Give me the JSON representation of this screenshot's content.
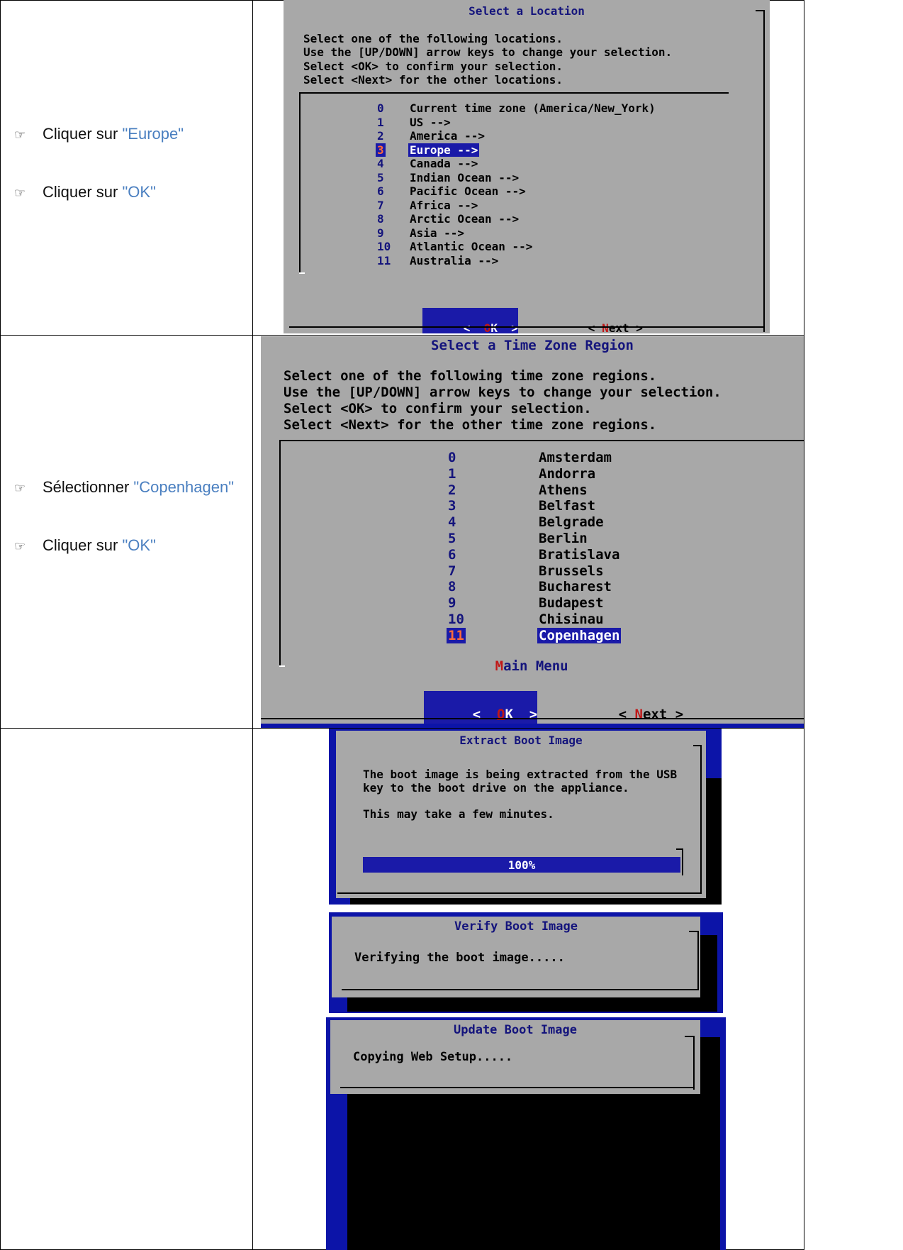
{
  "rows": [
    {
      "steps": [
        {
          "icon": "pointing-hand-icon",
          "prefix": "Cliquer sur ",
          "target": "\"Europe\""
        },
        {
          "icon": "pointing-hand-icon",
          "prefix": "Cliquer sur ",
          "target": "\"OK\""
        }
      ],
      "dialog": {
        "title": "Select a Location",
        "instructions": [
          "Select one of the following locations.",
          "Use the [UP/DOWN] arrow keys to change your selection.",
          "Select <OK> to confirm your selection.",
          "Select <Next> for the other locations."
        ],
        "items": [
          {
            "num": "0",
            "label": "Current time zone (America/New_York)"
          },
          {
            "num": "1",
            "label": "US -->"
          },
          {
            "num": "2",
            "label": "America -->"
          },
          {
            "num": "3",
            "label": "Europe -->"
          },
          {
            "num": "4",
            "label": "Canada -->"
          },
          {
            "num": "5",
            "label": "Indian Ocean -->"
          },
          {
            "num": "6",
            "label": "Pacific Ocean -->"
          },
          {
            "num": "7",
            "label": "Africa -->"
          },
          {
            "num": "8",
            "label": "Arctic Ocean -->"
          },
          {
            "num": "9",
            "label": "Asia -->"
          },
          {
            "num": "10",
            "label": "Atlantic Ocean -->"
          },
          {
            "num": "11",
            "label": "Australia -->"
          }
        ],
        "selected_index": 3,
        "ok_button": {
          "left": "<",
          "hot": "O",
          "rest": "K",
          "right": ">"
        },
        "next_button": {
          "left": "< ",
          "hot": "N",
          "rest": "ext",
          "right": " >"
        }
      }
    },
    {
      "steps": [
        {
          "icon": "pointing-hand-icon",
          "prefix": "Sélectionner ",
          "target": "\"Copenhagen\""
        },
        {
          "icon": "pointing-hand-icon",
          "prefix": "Cliquer sur ",
          "target": "\"OK\""
        }
      ],
      "dialog": {
        "title": "Select a Time Zone Region",
        "instructions": [
          "Select one of the following time zone regions.",
          "Use the [UP/DOWN] arrow keys to change your selection.",
          "Select <OK> to confirm your selection.",
          "Select <Next> for the other time zone regions."
        ],
        "items": [
          {
            "num": "0",
            "label": "Amsterdam"
          },
          {
            "num": "1",
            "label": "Andorra"
          },
          {
            "num": "2",
            "label": "Athens"
          },
          {
            "num": "3",
            "label": "Belfast"
          },
          {
            "num": "4",
            "label": "Belgrade"
          },
          {
            "num": "5",
            "label": "Berlin"
          },
          {
            "num": "6",
            "label": "Bratislava"
          },
          {
            "num": "7",
            "label": "Brussels"
          },
          {
            "num": "8",
            "label": "Bucharest"
          },
          {
            "num": "9",
            "label": "Budapest"
          },
          {
            "num": "10",
            "label": "Chisinau"
          },
          {
            "num": "11",
            "label": "Copenhagen"
          }
        ],
        "selected_index": 11,
        "main_menu": {
          "hot": "M",
          "rest": "ain Menu"
        },
        "ok_button": {
          "left": "<",
          "hot": "O",
          "rest": "K",
          "right": ">"
        },
        "next_button": {
          "left": "< ",
          "hot": "N",
          "rest": "ext",
          "right": " >"
        }
      }
    },
    {
      "dialogs": {
        "extract": {
          "title": "Extract Boot Image",
          "lines": [
            "The boot image is being extracted from the USB",
            "key to the boot drive on the appliance."
          ],
          "note": "This may take a few minutes.",
          "progress_text": "100%",
          "progress_fraction": 1.0
        },
        "verify": {
          "title": "Verify Boot Image",
          "message": "Verifying the boot image....."
        },
        "update": {
          "title": "Update Boot Image",
          "message": "Copying Web Setup....."
        }
      }
    }
  ],
  "colors": {
    "dialog_bg": "#a8a8a8",
    "title_blue": "#14147c",
    "select_blue": "#1a1aa8",
    "hotkey_red": "#c01818",
    "link_blue": "#4a7fc0",
    "screen_blue": "#0c14a8"
  }
}
